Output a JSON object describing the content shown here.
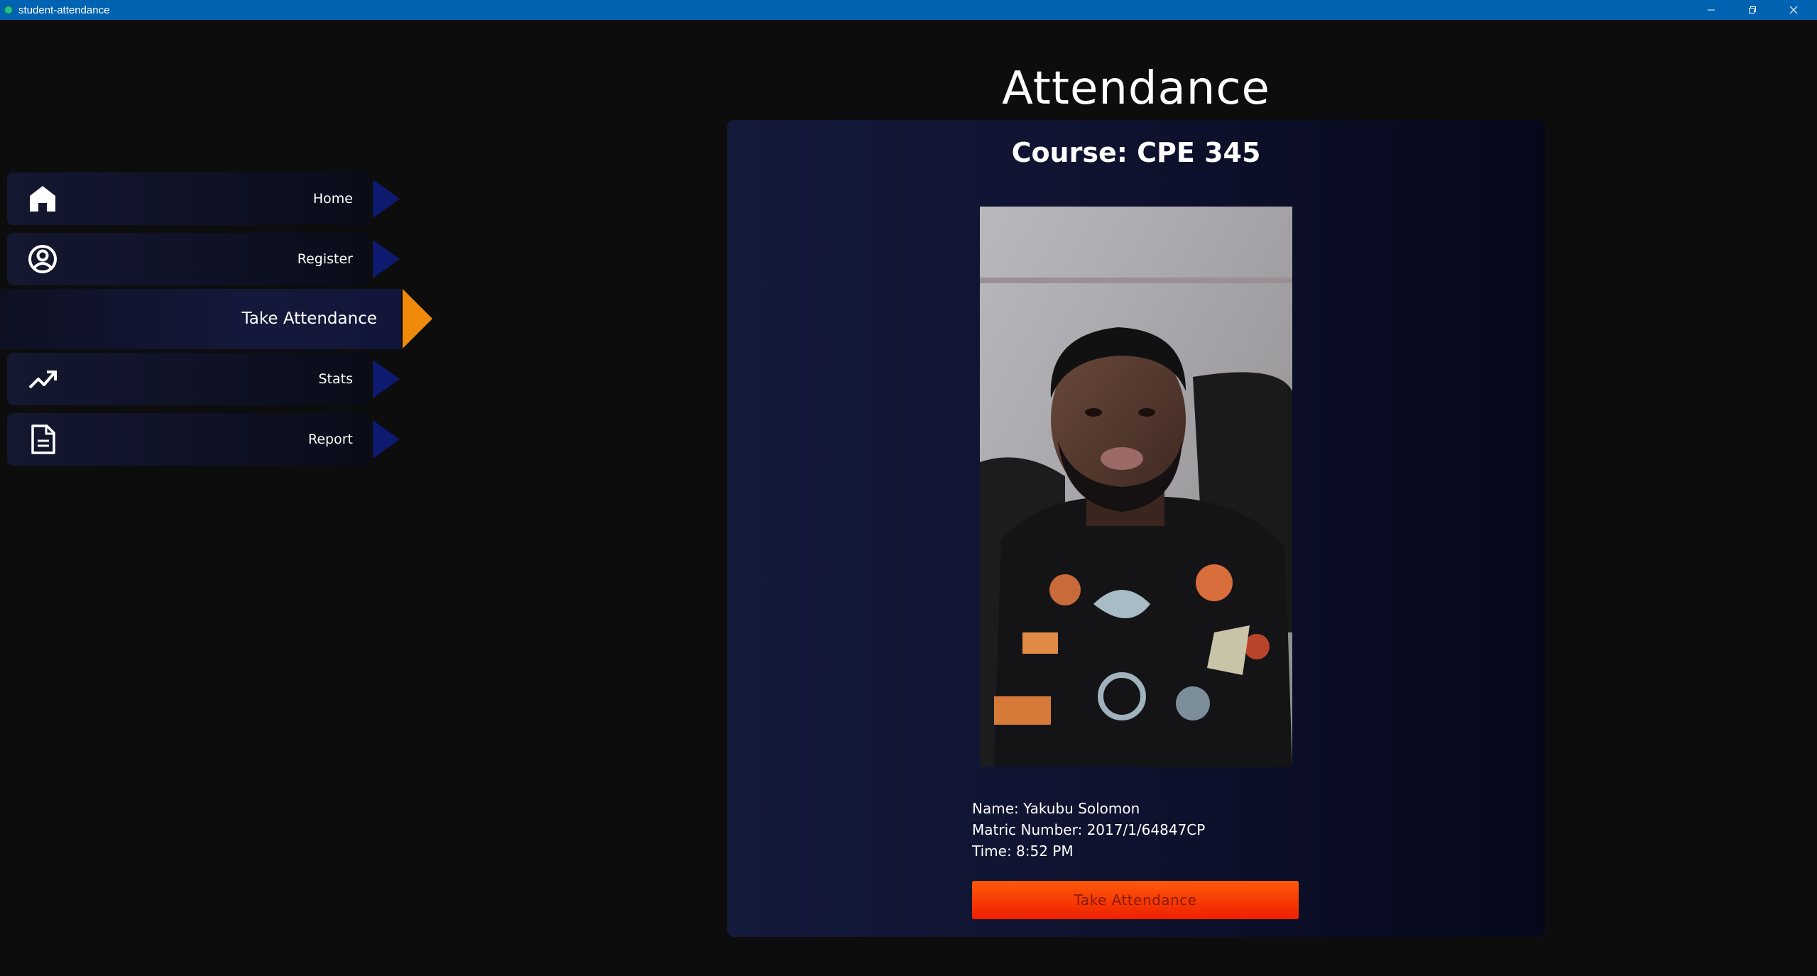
{
  "window": {
    "title": "student-attendance",
    "accent": "#0063b1"
  },
  "sidebar": {
    "items": [
      {
        "label": "Home",
        "icon": "home-icon"
      },
      {
        "label": "Register",
        "icon": "user-circle-icon"
      },
      {
        "label": "Take Attendance",
        "icon": "",
        "active": true
      },
      {
        "label": "Stats",
        "icon": "trending-up-icon"
      },
      {
        "label": "Report",
        "icon": "document-icon"
      }
    ],
    "active_arrow_color": "#ef8a0c",
    "inactive_arrow_color": "#0d1a70"
  },
  "main": {
    "title": "Attendance",
    "course_heading": "Course: CPE 345",
    "photo": "student-portrait",
    "student": {
      "name_line": "Name: Yakubu Solomon",
      "matric_line": "Matric Number: 2017/1/64847CP",
      "time_line": "Time: 8:52 PM"
    },
    "button_label": "Take Attendance",
    "button_color": "#ff4a05"
  }
}
